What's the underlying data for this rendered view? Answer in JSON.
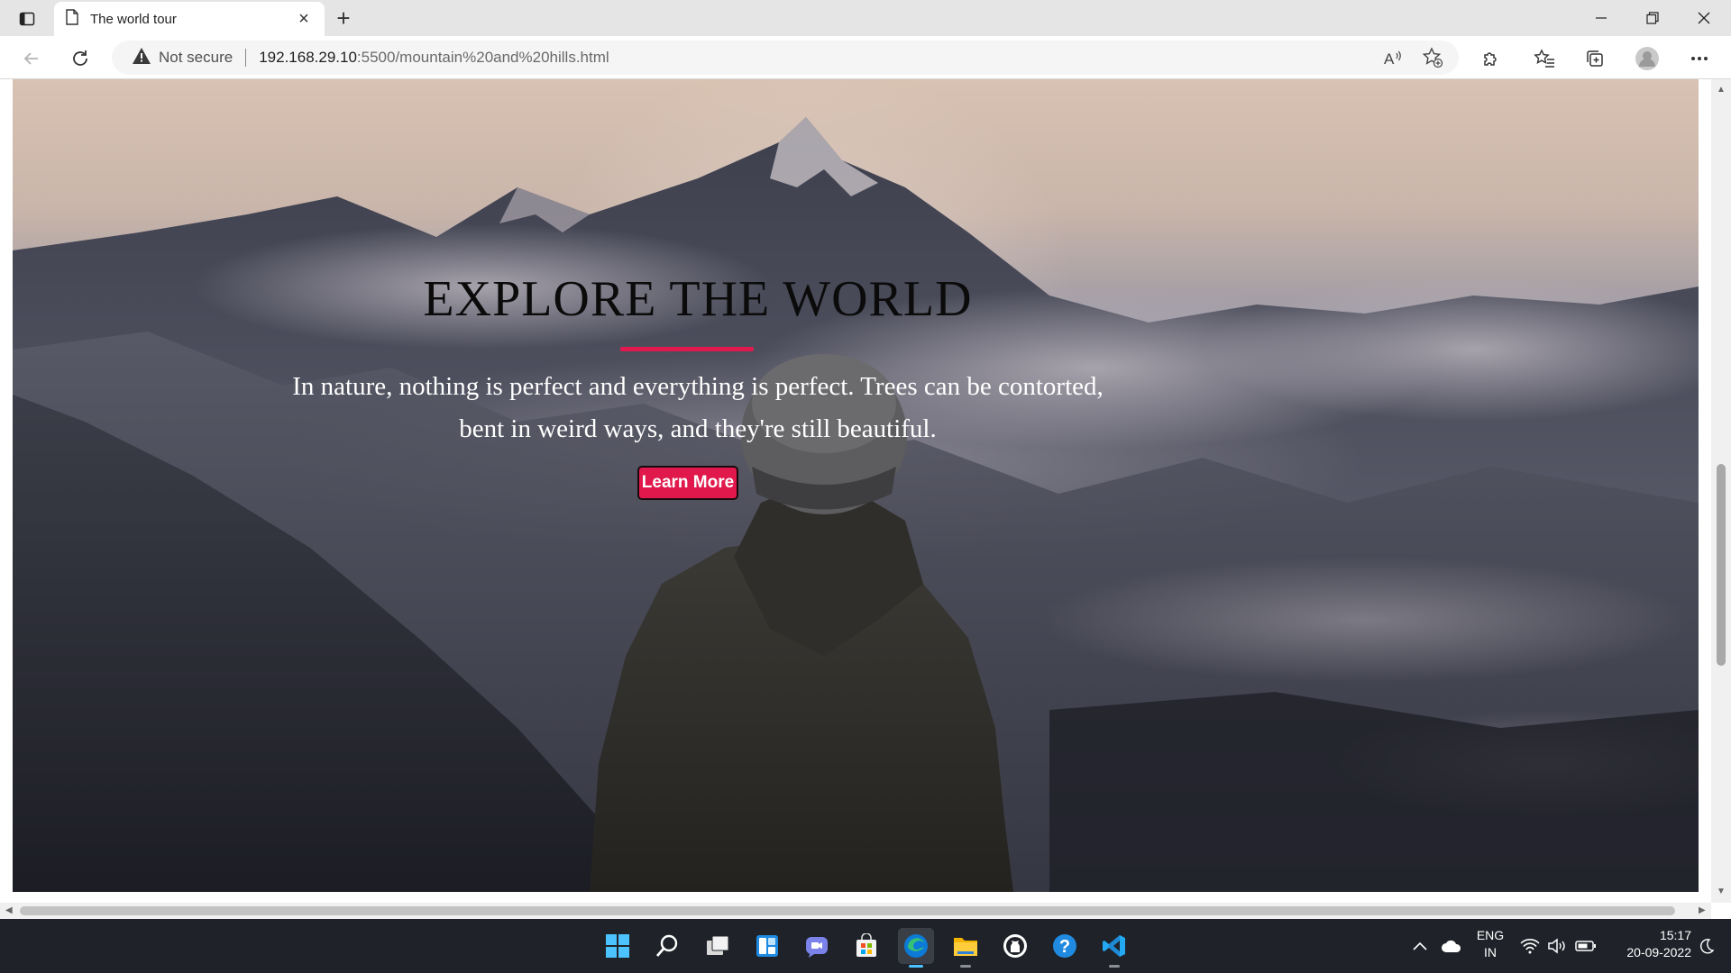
{
  "browser": {
    "tab_title": "The world tour",
    "close_tab": "×",
    "new_tab": "+",
    "address": {
      "security": "Not secure",
      "host": "192.168.29.10",
      "path": ":5500/mountain%20and%20hills.html"
    }
  },
  "hero": {
    "title": "EXPLORE THE WORLD",
    "text_line1": "In nature, nothing is perfect and everything is perfect. Trees can be contorted,",
    "text_line2": "bent in weird ways, and they're still beautiful.",
    "button_label": "Learn More",
    "accent_color": "#e0184b"
  },
  "taskbar": {
    "apps": [
      "start-icon",
      "search-icon",
      "task-view-icon",
      "widgets-icon",
      "teams-chat-icon",
      "store-icon",
      "edge-icon",
      "file-explorer-icon",
      "github-icon",
      "help-icon",
      "vscode-icon"
    ],
    "language_top": "ENG",
    "language_bottom": "IN",
    "time": "15:17",
    "date": "20-09-2022"
  }
}
